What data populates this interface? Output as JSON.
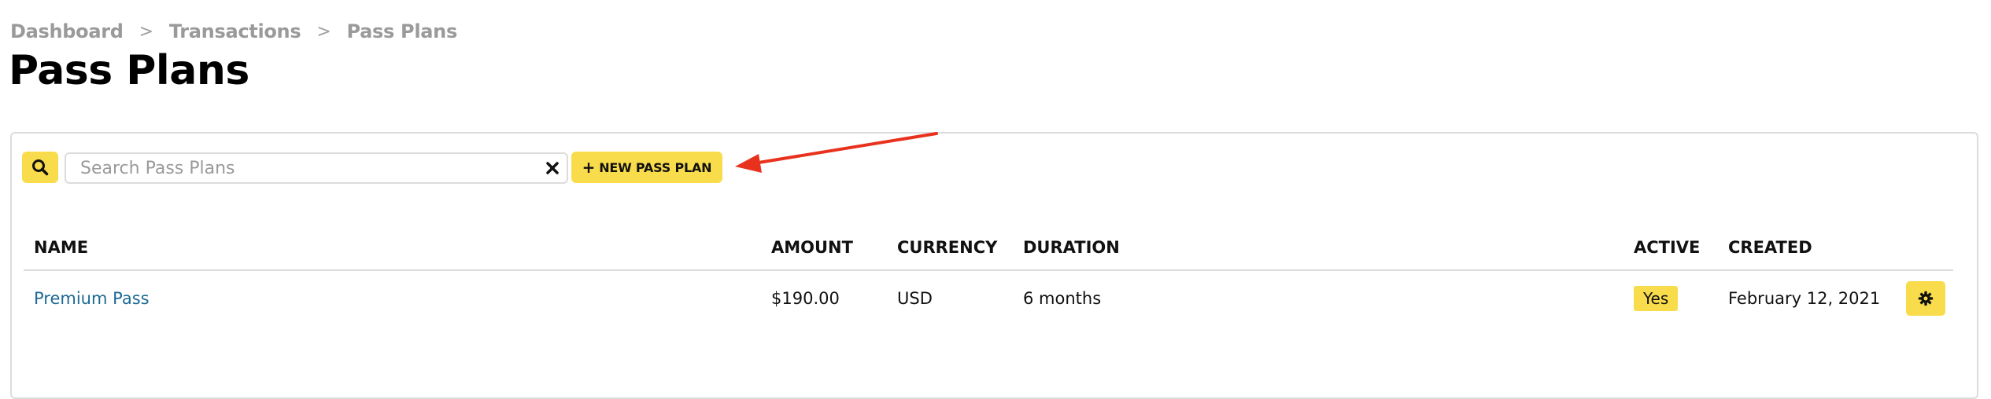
{
  "breadcrumb": {
    "items": [
      "Dashboard",
      "Transactions",
      "Pass Plans"
    ],
    "separator": ">"
  },
  "page": {
    "title": "Pass Plans"
  },
  "toolbar": {
    "search_placeholder": "Search Pass Plans",
    "search_value": "",
    "new_button_label": "NEW PASS PLAN",
    "new_button_prefix": "+",
    "accent_color": "#f9dc4b"
  },
  "annotation": {
    "arrow_color": "#e8321e"
  },
  "table": {
    "columns": {
      "name": "NAME",
      "amount": "AMOUNT",
      "currency": "CURRENCY",
      "duration": "DURATION",
      "active": "ACTIVE",
      "created": "CREATED"
    },
    "rows": [
      {
        "name": "Premium Pass",
        "amount": "$190.00",
        "currency": "USD",
        "duration": "6 months",
        "active": "Yes",
        "created": "February 12, 2021"
      }
    ]
  },
  "icons": {
    "search": "search-icon",
    "clear": "close-icon",
    "settings": "gear-icon"
  }
}
